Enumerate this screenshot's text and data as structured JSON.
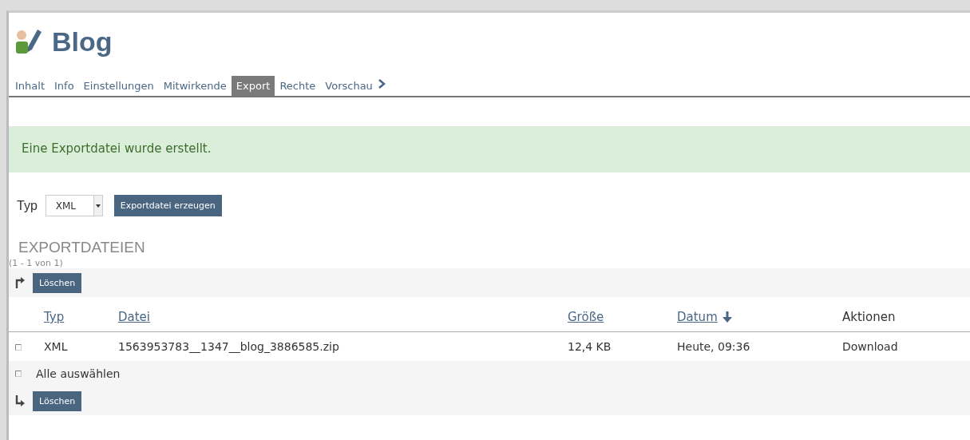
{
  "header": {
    "title": "Blog"
  },
  "tabs": [
    {
      "label": "Inhalt",
      "selected": false
    },
    {
      "label": "Info",
      "selected": false
    },
    {
      "label": "Einstellungen",
      "selected": false
    },
    {
      "label": "Mitwirkende",
      "selected": false
    },
    {
      "label": "Export",
      "selected": true
    },
    {
      "label": "Rechte",
      "selected": false
    },
    {
      "label": "Vorschau",
      "selected": false
    }
  ],
  "message": "Eine Exportdatei wurde erstellt.",
  "export_form": {
    "label": "Typ",
    "type_select": "XML",
    "button": "Exportdatei erzeugen"
  },
  "files": {
    "heading": "EXPORTDATEIEN",
    "count": "(1 - 1 von 1)",
    "top_action": "Löschen",
    "bottom_action": "Löschen",
    "columns": [
      {
        "label": "Typ",
        "sortable": true,
        "sorted": false
      },
      {
        "label": "Datei",
        "sortable": true,
        "sorted": false
      },
      {
        "label": "Größe",
        "sortable": true,
        "sorted": false
      },
      {
        "label": "Datum",
        "sortable": true,
        "sorted": true
      },
      {
        "label": "Aktionen",
        "sortable": false,
        "sorted": false
      }
    ],
    "rows": [
      {
        "checked": false,
        "cells": [
          "XML",
          "1563953783__1347__blog_3886585.zip",
          "12,4 KB",
          "Heute, 09:36"
        ],
        "action": "Download"
      }
    ],
    "select_all": {
      "label": "Alle auswählen",
      "checked": false
    }
  }
}
